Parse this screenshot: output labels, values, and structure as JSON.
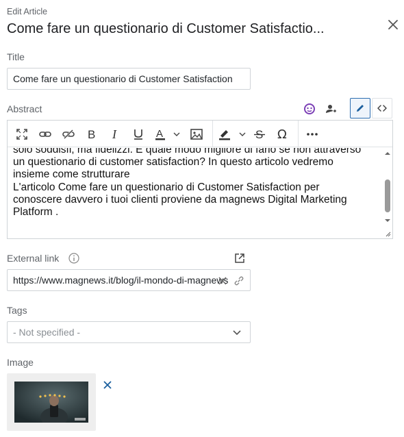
{
  "header": {
    "subtitle": "Edit Article",
    "title": "Come fare un questionario di Customer Satisfactio..."
  },
  "title_field": {
    "label": "Title",
    "value": "Come fare un questionario di Customer Satisfaction"
  },
  "abstract": {
    "label": "Abstract",
    "lines": [
      "solo soddisfi, ma fidelizzi. E quale modo migliore di farlo se non attraverso",
      "un questionario di customer satisfaction? In questo articolo vedremo",
      "insieme come strutturare",
      "L'articolo Come fare un questionario di Customer Satisfaction per",
      "conoscere davvero i tuoi clienti proviene da magnews Digital Marketing",
      "Platform ."
    ],
    "toolbar_icons": [
      "fullscreen-icon",
      "link-icon",
      "unlink-icon",
      "bold-icon",
      "italic-icon",
      "underline-icon",
      "font-color-icon",
      "image-icon",
      "highlight-icon",
      "strikethrough-icon",
      "special-char-icon",
      "more-icon"
    ]
  },
  "external_link": {
    "label": "External link",
    "value": "https://www.magnews.it/blog/il-mondo-di-magnews"
  },
  "tags": {
    "label": "Tags",
    "placeholder": "- Not specified -"
  },
  "image": {
    "label": "Image"
  },
  "colors": {
    "accent": "#1a5f9e",
    "ai_purple": "#7b3fb5",
    "active_border": "#2b6cb0"
  }
}
